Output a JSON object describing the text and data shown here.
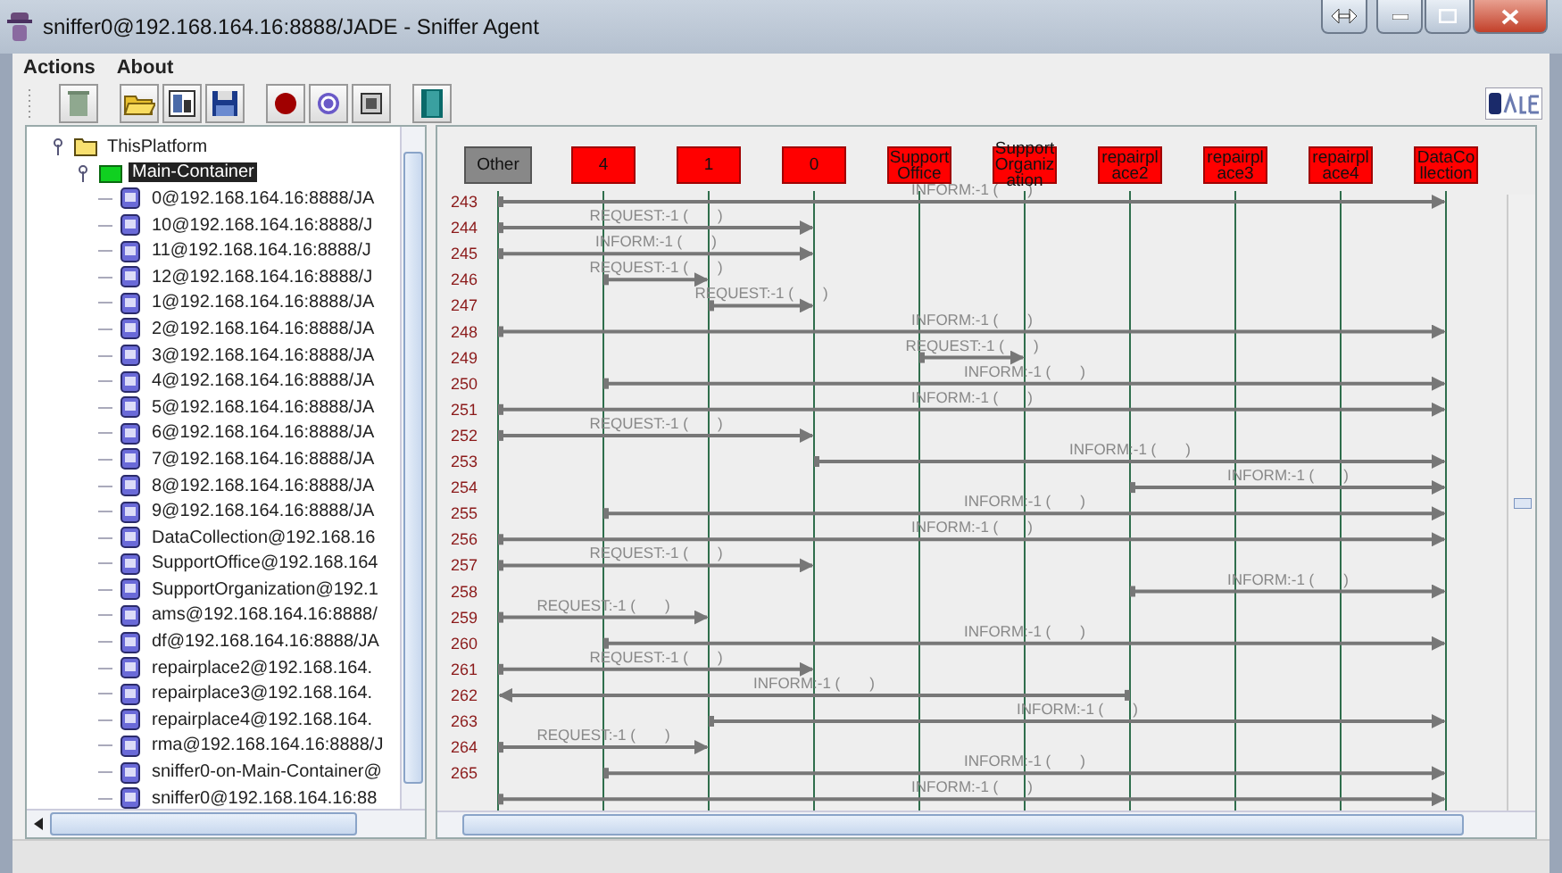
{
  "window": {
    "title": "sniffer0@192.168.164.16:8888/JADE - Sniffer Agent"
  },
  "menu": [
    "Actions",
    "About"
  ],
  "tree": [
    {
      "label": "ThisPlatform",
      "kind": "platform",
      "expanded": true,
      "selected": false,
      "children": [
        {
          "label": "Main-Container",
          "kind": "container",
          "expanded": true,
          "selected": true,
          "children": [
            {
              "label": "0@192.168.164.16:8888/JA",
              "kind": "agent",
              "selected": false
            },
            {
              "label": "10@192.168.164.16:8888/J",
              "kind": "agent",
              "selected": false
            },
            {
              "label": "11@192.168.164.16:8888/J",
              "kind": "agent",
              "selected": false
            },
            {
              "label": "12@192.168.164.16:8888/J",
              "kind": "agent",
              "selected": false
            },
            {
              "label": "1@192.168.164.16:8888/JA",
              "kind": "agent",
              "selected": false
            },
            {
              "label": "2@192.168.164.16:8888/JA",
              "kind": "agent",
              "selected": false
            },
            {
              "label": "3@192.168.164.16:8888/JA",
              "kind": "agent",
              "selected": false
            },
            {
              "label": "4@192.168.164.16:8888/JA",
              "kind": "agent",
              "selected": false
            },
            {
              "label": "5@192.168.164.16:8888/JA",
              "kind": "agent",
              "selected": false
            },
            {
              "label": "6@192.168.164.16:8888/JA",
              "kind": "agent",
              "selected": false
            },
            {
              "label": "7@192.168.164.16:8888/JA",
              "kind": "agent",
              "selected": false
            },
            {
              "label": "8@192.168.164.16:8888/JA",
              "kind": "agent",
              "selected": false
            },
            {
              "label": "9@192.168.164.16:8888/JA",
              "kind": "agent",
              "selected": false
            },
            {
              "label": "DataCollection@192.168.16",
              "kind": "agent",
              "selected": false
            },
            {
              "label": "SupportOffice@192.168.164",
              "kind": "agent",
              "selected": false
            },
            {
              "label": "SupportOrganization@192.1",
              "kind": "agent",
              "selected": false
            },
            {
              "label": "ams@192.168.164.16:8888/",
              "kind": "agent",
              "selected": false
            },
            {
              "label": "df@192.168.164.16:8888/JA",
              "kind": "agent",
              "selected": false
            },
            {
              "label": "repairplace2@192.168.164.",
              "kind": "agent",
              "selected": false
            },
            {
              "label": "repairplace3@192.168.164.",
              "kind": "agent",
              "selected": false
            },
            {
              "label": "repairplace4@192.168.164.",
              "kind": "agent",
              "selected": false
            },
            {
              "label": "rma@192.168.164.16:8888/J",
              "kind": "agent",
              "selected": false
            },
            {
              "label": "sniffer0-on-Main-Container@",
              "kind": "agent",
              "selected": false
            },
            {
              "label": "sniffer0@192.168.164.16:88",
              "kind": "agent",
              "selected": false
            }
          ]
        }
      ]
    }
  ],
  "diagram": {
    "agents": [
      {
        "name": "Other",
        "kind": "other"
      },
      {
        "name": "4",
        "kind": "agent"
      },
      {
        "name": "1",
        "kind": "agent"
      },
      {
        "name": "0",
        "kind": "agent"
      },
      {
        "name": "SupportOffice",
        "kind": "agent"
      },
      {
        "name": "SupportOrganization",
        "kind": "agent"
      },
      {
        "name": "repairplace2",
        "kind": "agent"
      },
      {
        "name": "repairplace3",
        "kind": "agent"
      },
      {
        "name": "repairplace4",
        "kind": "agent"
      },
      {
        "name": "DataCollection",
        "kind": "agent"
      }
    ],
    "messages": [
      {
        "number": "243",
        "label": "INFORM:-1 (       )"
      },
      {
        "number": "244",
        "label": "REQUEST:-1 (       )"
      },
      {
        "number": "245",
        "label": "INFORM:-1 (       )"
      },
      {
        "number": "246",
        "label": "REQUEST:-1 (       )"
      },
      {
        "number": "247",
        "label": "REQUEST:-1 (       )"
      },
      {
        "number": "248",
        "label": "INFORM:-1 (       )"
      },
      {
        "number": "249",
        "label": "REQUEST:-1 (       )"
      },
      {
        "number": "250",
        "label": "INFORM:-1 (       )"
      },
      {
        "number": "251",
        "label": "INFORM:-1 (       )"
      },
      {
        "number": "252",
        "label": "REQUEST:-1 (       )"
      },
      {
        "number": "253",
        "label": "INFORM:-1 (       )"
      },
      {
        "number": "254",
        "label": "INFORM:-1 (       )"
      },
      {
        "number": "255",
        "label": "INFORM:-1 (       )"
      },
      {
        "number": "256",
        "label": "INFORM:-1 (       )"
      },
      {
        "number": "257",
        "label": "REQUEST:-1 (       )"
      },
      {
        "number": "258",
        "label": "INFORM:-1 (       )"
      },
      {
        "number": "259",
        "label": "REQUEST:-1 (       )"
      },
      {
        "number": "260",
        "label": "INFORM:-1 (       )"
      },
      {
        "number": "261",
        "label": "REQUEST:-1 (       )"
      },
      {
        "number": "262",
        "label": "INFORM:-1 (       )"
      },
      {
        "number": "263",
        "label": "INFORM:-1 (       )"
      },
      {
        "number": "264",
        "label": "REQUEST:-1 (       )"
      },
      {
        "number": "265",
        "label": "INFORM:-1 (       )"
      },
      {
        "label": "INFORM:-1 (       )"
      }
    ]
  }
}
